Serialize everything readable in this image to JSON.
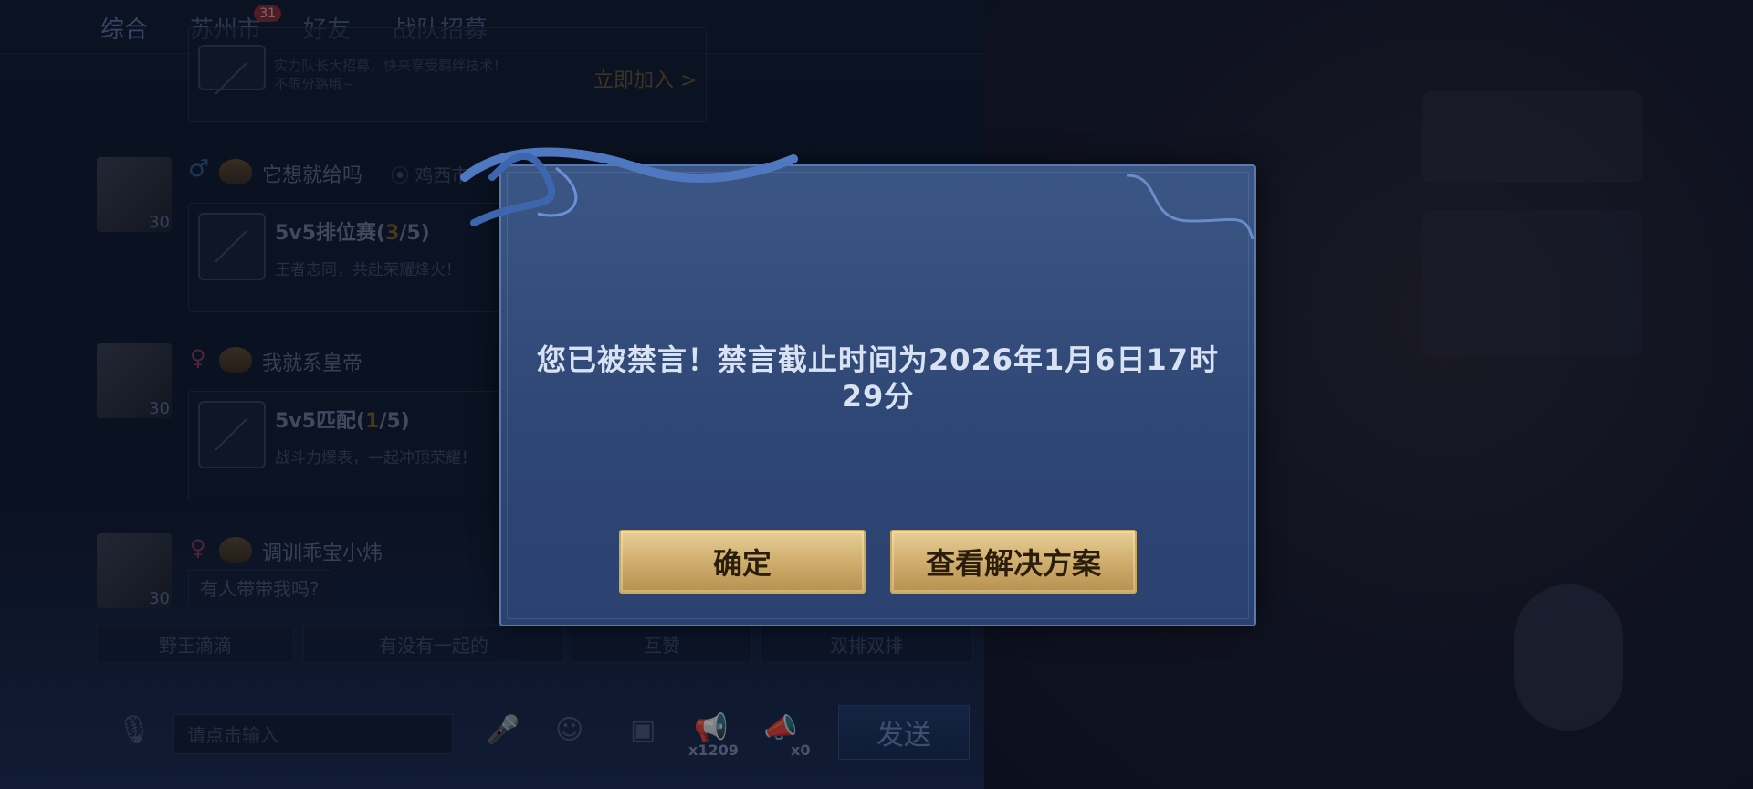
{
  "tabs": [
    {
      "label": "综合",
      "active": true
    },
    {
      "label": "苏州市",
      "badge": "31"
    },
    {
      "label": "好友"
    },
    {
      "label": "战队招募"
    }
  ],
  "feed": {
    "first_card": {
      "desc_line1": "实力队长大招募，快来享受羁绊技术！",
      "desc_line2": "不限分路哦~",
      "join_link": "立即加入 >"
    },
    "posts": [
      {
        "username": "它想就给吗",
        "gender": "♂",
        "level": "30",
        "location": "鸡西市",
        "card_title": "5v5排位赛",
        "card_count_open": "(",
        "card_count": "3",
        "card_count_total": "/5)",
        "card_desc": "王者志同，共赴荣耀烽火！"
      },
      {
        "username": "我就系皇帝",
        "gender": "♀",
        "level": "30",
        "card_title": "5v5匹配",
        "card_count_open": "(",
        "card_count": "1",
        "card_count_total": "/5)",
        "card_desc": "战斗力爆表，一起冲顶荣耀！"
      },
      {
        "username": "调训乖宝小炜",
        "gender": "♀",
        "level": "30",
        "chat_message": "有人带带我吗?"
      }
    ]
  },
  "quick_tags": [
    "野王滴滴",
    "有没有一起的",
    "互赞",
    "双排双排"
  ],
  "input": {
    "placeholder": "请点击输入",
    "horn_count": "x1209",
    "small_horn_count": "x0",
    "send_label": "发送"
  },
  "dialog": {
    "message": "您已被禁言！禁言截止时间为2026年1月6日17时29分",
    "confirm_label": "确定",
    "solution_label": "查看解决方案"
  },
  "colors": {
    "dialog_bg": "#33507e",
    "button_gold": "#d2b171",
    "message_text": "#d9e2f2"
  }
}
